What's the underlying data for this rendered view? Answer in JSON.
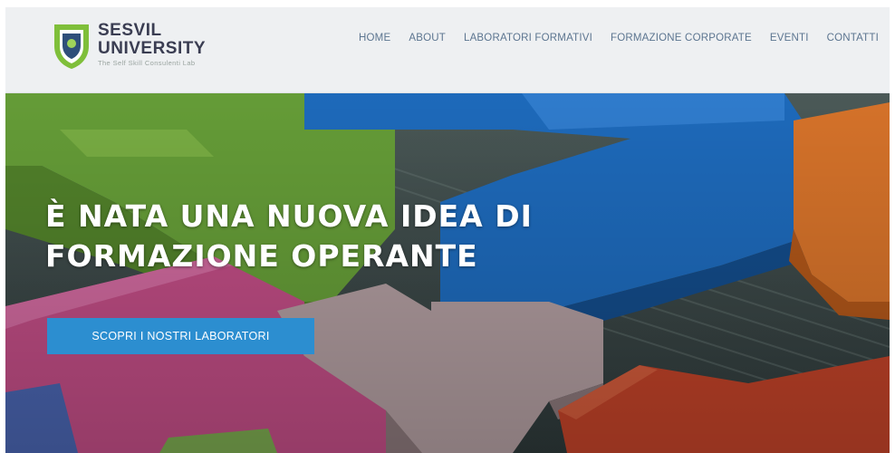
{
  "brand": {
    "name_line1": "SESVIL",
    "name_line2": "UNIVERSITY",
    "tagline": "The Self Skill Consulenti Lab",
    "logo_colors": {
      "green": "#7fbf3a",
      "navy": "#2f4f7a"
    }
  },
  "nav": {
    "items": [
      {
        "label": "HOME"
      },
      {
        "label": "ABOUT"
      },
      {
        "label": "LABORATORI FORMATIVI"
      },
      {
        "label": "FORMAZIONE CORPORATE"
      },
      {
        "label": "EVENTI"
      },
      {
        "label": "CONTATTI"
      }
    ]
  },
  "hero": {
    "title_line1": "È NATA UNA NUOVA IDEA DI",
    "title_line2": "FORMAZIONE OPERANTE",
    "cta_label": "SCOPRI I NOSTRI LABORATORI",
    "image": "colorful wooden puzzle blocks",
    "accent_color": "#2c8ed0"
  }
}
